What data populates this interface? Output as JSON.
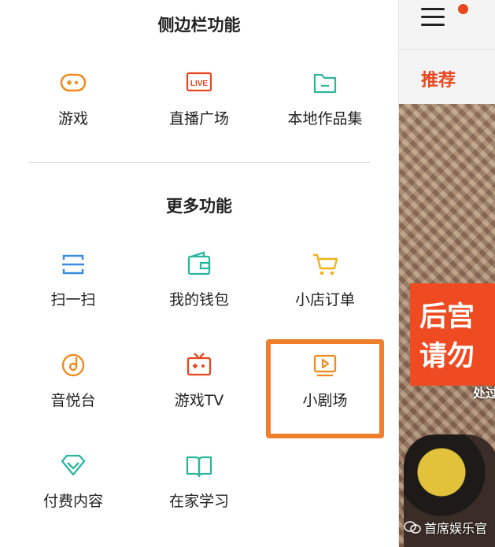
{
  "sidebar_section": {
    "title": "侧边栏功能",
    "items": [
      {
        "label": "游戏",
        "icon": "gamepad-icon"
      },
      {
        "label": "直播广场",
        "icon": "live-icon",
        "badge": "LIVE"
      },
      {
        "label": "本地作品集",
        "icon": "folder-icon"
      }
    ]
  },
  "more_section": {
    "title": "更多功能",
    "items": [
      {
        "label": "扫一扫",
        "icon": "scan-icon"
      },
      {
        "label": "我的钱包",
        "icon": "wallet-icon"
      },
      {
        "label": "小店订单",
        "icon": "cart-icon"
      },
      {
        "label": "音悦台",
        "icon": "music-disc-icon"
      },
      {
        "label": "游戏TV",
        "icon": "tv-icon"
      },
      {
        "label": "小剧场",
        "icon": "play-screen-icon",
        "highlighted": true
      },
      {
        "label": "付费内容",
        "icon": "diamond-icon"
      },
      {
        "label": "在家学习",
        "icon": "book-icon"
      }
    ]
  },
  "background": {
    "tab_label": "推荐",
    "banner_line1": "后宫",
    "banner_line2": "请勿",
    "sub_label": "处过",
    "watermark": "首席娱乐官"
  },
  "colors": {
    "orange": "#f08a1c",
    "red": "#e8461f",
    "green": "#2cb69c",
    "blue": "#3b8ddc",
    "yellow": "#f3b21a",
    "highlight_border": "#f07f2c"
  }
}
